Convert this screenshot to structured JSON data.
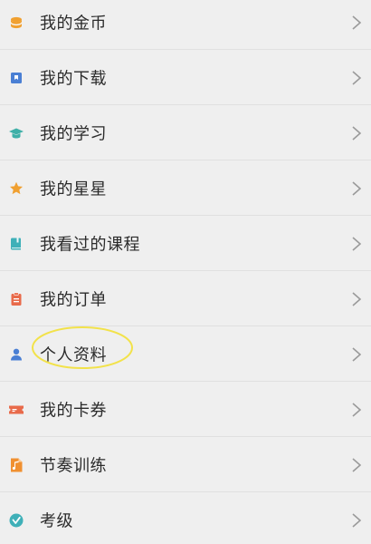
{
  "menu": {
    "items": [
      {
        "label": "我的金币",
        "icon": "coin-icon",
        "color": "#f0a030"
      },
      {
        "label": "我的下载",
        "icon": "download-icon",
        "color": "#4a7fd4"
      },
      {
        "label": "我的学习",
        "icon": "graduation-cap-icon",
        "color": "#3fb0a8"
      },
      {
        "label": "我的星星",
        "icon": "star-icon",
        "color": "#f0a030"
      },
      {
        "label": "我看过的课程",
        "icon": "book-icon",
        "color": "#3fb0b8"
      },
      {
        "label": "我的订单",
        "icon": "order-icon",
        "color": "#e86a4a"
      },
      {
        "label": "个人资料",
        "icon": "person-icon",
        "color": "#4a7fd4"
      },
      {
        "label": "我的卡券",
        "icon": "ticket-icon",
        "color": "#e86a4a"
      },
      {
        "label": "节奏训练",
        "icon": "music-note-icon",
        "color": "#f09030"
      },
      {
        "label": "考级",
        "icon": "checkmark-badge-icon",
        "color": "#3fb0b8"
      }
    ],
    "highlight_color": "#f2e24a"
  }
}
